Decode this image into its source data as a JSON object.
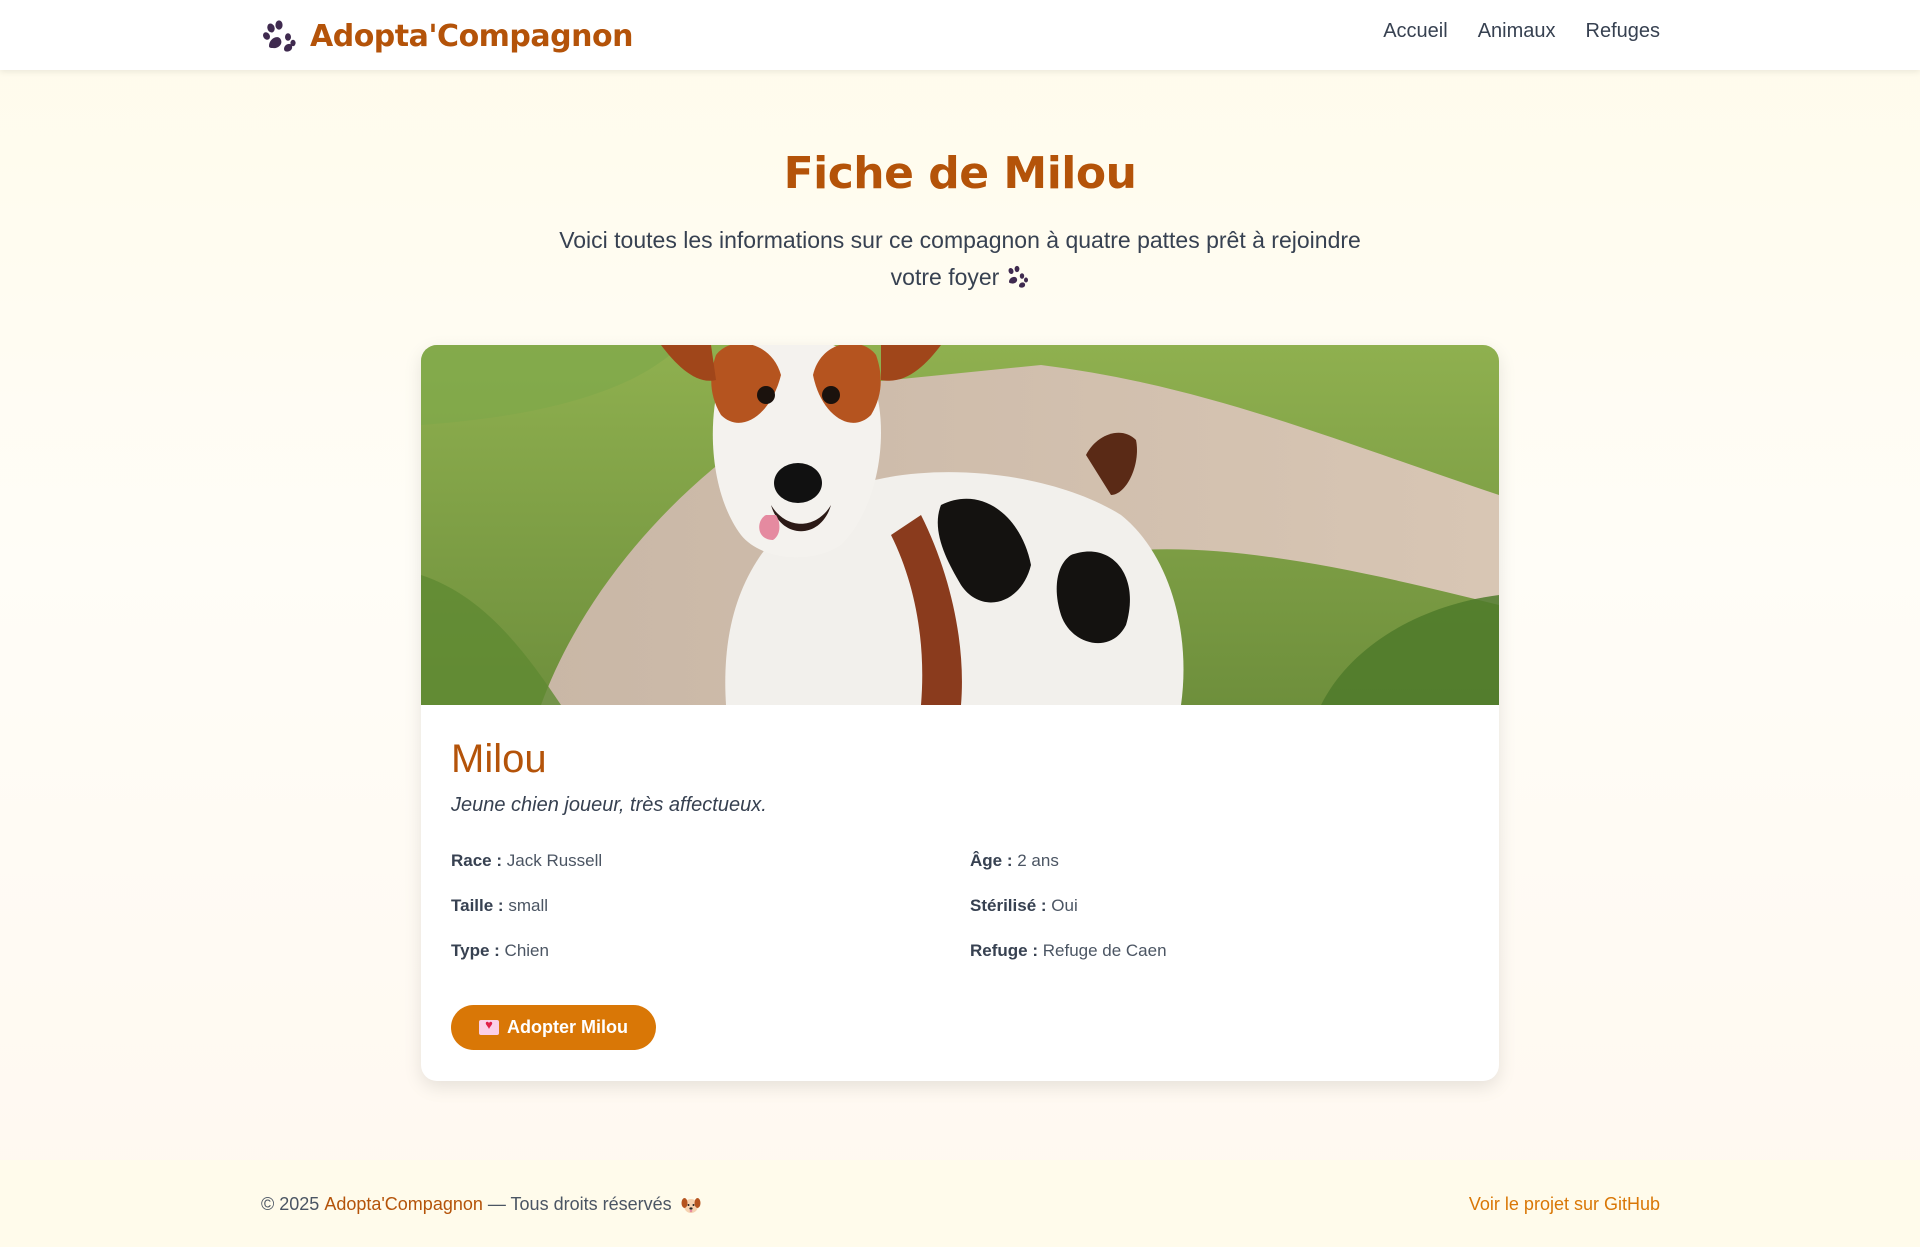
{
  "header": {
    "brand_name": "Adopta'Compagnon",
    "brand_icon": "paw-icon",
    "nav": [
      {
        "label": "Accueil"
      },
      {
        "label": "Animaux"
      },
      {
        "label": "Refuges"
      }
    ]
  },
  "hero": {
    "title": "Fiche de Milou",
    "subtitle": "Voici toutes les informations sur ce compagnon à quatre pattes prêt à rejoindre votre foyer"
  },
  "pet": {
    "name": "Milou",
    "description": "Jeune chien joueur, très affectueux.",
    "fields": {
      "race_label": "Race :",
      "race_value": "Jack Russell",
      "age_label": "Âge :",
      "age_value": "2 ans",
      "taille_label": "Taille :",
      "taille_value": "small",
      "sterilise_label": "Stérilisé :",
      "sterilise_value": "Oui",
      "type_label": "Type :",
      "type_value": "Chien",
      "refuge_label": "Refuge :",
      "refuge_value": "Refuge de Caen"
    },
    "adopt_button": "Adopter Milou"
  },
  "footer": {
    "copyright": "© 2025",
    "brand": "Adopta'Compagnon",
    "rights": "— Tous droits réservés",
    "github_link": "Voir le projet sur GitHub"
  },
  "colors": {
    "brand": "#b45309",
    "accent": "#d97706",
    "text": "#374151"
  }
}
